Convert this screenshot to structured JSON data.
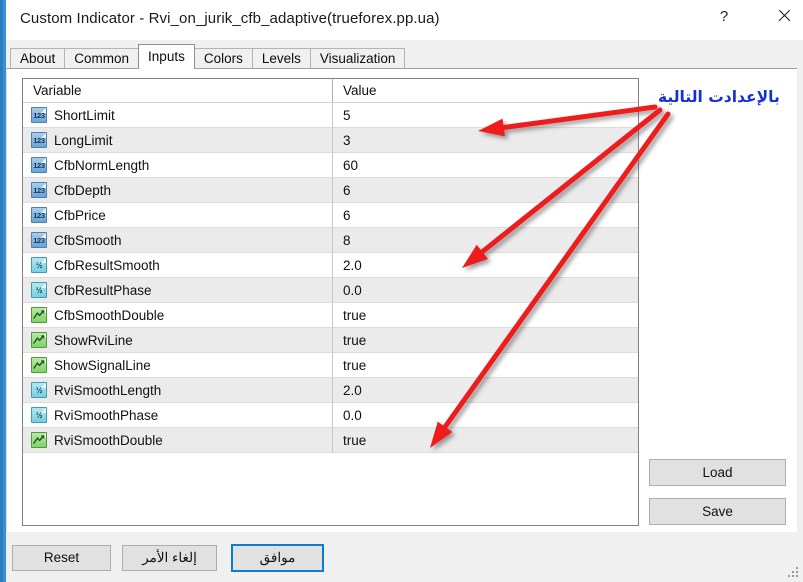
{
  "window": {
    "title": "Custom Indicator - Rvi_on_jurik_cfb_adaptive(trueforex.pp.ua)",
    "help_label": "?",
    "close_label": "×"
  },
  "tabs": [
    {
      "label": "About",
      "active": false
    },
    {
      "label": "Common",
      "active": false
    },
    {
      "label": "Inputs",
      "active": true
    },
    {
      "label": "Colors",
      "active": false
    },
    {
      "label": "Levels",
      "active": false
    },
    {
      "label": "Visualization",
      "active": false
    }
  ],
  "grid": {
    "headers": {
      "variable": "Variable",
      "value": "Value"
    },
    "rows": [
      {
        "icon": "int",
        "variable": "ShortLimit",
        "value": "5"
      },
      {
        "icon": "int",
        "variable": "LongLimit",
        "value": "3"
      },
      {
        "icon": "int",
        "variable": "CfbNormLength",
        "value": "60"
      },
      {
        "icon": "int",
        "variable": "CfbDepth",
        "value": "6"
      },
      {
        "icon": "int",
        "variable": "CfbPrice",
        "value": "6"
      },
      {
        "icon": "int",
        "variable": "CfbSmooth",
        "value": "8"
      },
      {
        "icon": "dbl",
        "variable": "CfbResultSmooth",
        "value": "2.0"
      },
      {
        "icon": "dbl",
        "variable": "CfbResultPhase",
        "value": "0.0"
      },
      {
        "icon": "bool",
        "variable": "CfbSmoothDouble",
        "value": "true"
      },
      {
        "icon": "bool",
        "variable": "ShowRviLine",
        "value": "true"
      },
      {
        "icon": "bool",
        "variable": "ShowSignalLine",
        "value": "true"
      },
      {
        "icon": "dbl",
        "variable": "RviSmoothLength",
        "value": "2.0"
      },
      {
        "icon": "dbl",
        "variable": "RviSmoothPhase",
        "value": "0.0"
      },
      {
        "icon": "bool",
        "variable": "RviSmoothDouble",
        "value": "true"
      }
    ],
    "icon_glyphs": {
      "int": "123",
      "dbl": "½",
      "bool": "line-chart"
    }
  },
  "side_buttons": {
    "load_label": "Load",
    "save_label": "Save"
  },
  "bottom_buttons": {
    "reset_label": "Reset",
    "cancel_label": "إلغاء الأمر",
    "ok_label": "موافق"
  },
  "annotation": {
    "text": "بالإعدادت التالية",
    "text_color": "#1630d8",
    "arrow_color": "#ee1b1b",
    "arrow_count": 3
  },
  "colors": {
    "accent": "#0b7bd4",
    "window_bg": "#f0f0f0",
    "panel_bg": "#ffffff",
    "row_alt_bg": "#ebebeb",
    "button_bg": "#e1e1e1"
  }
}
